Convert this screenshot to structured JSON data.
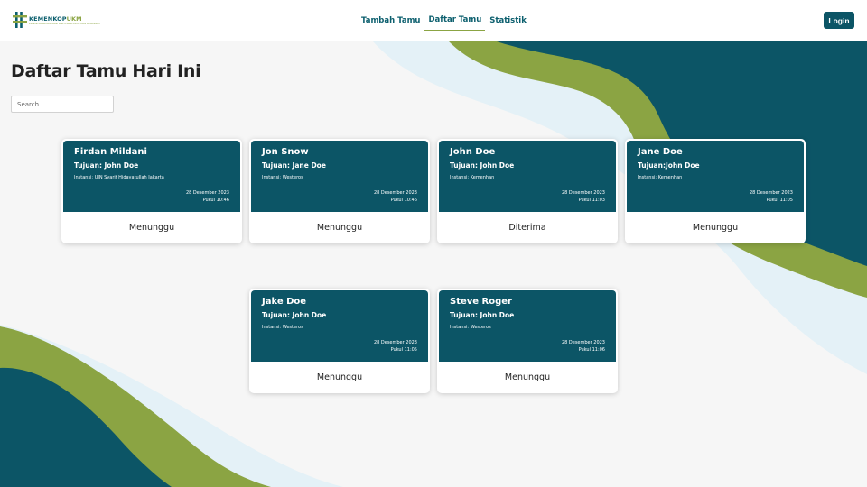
{
  "navbar": {
    "logo_text_main": "KEMENKOP",
    "logo_text_accent": "UKM",
    "logo_subtext": "KEMENTERIAN KOPERASI DAN USAHA KECIL DAN MENENGAH",
    "links": [
      {
        "label": "Tambah Tamu",
        "active": false
      },
      {
        "label": "Daftar Tamu",
        "active": true
      },
      {
        "label": "Statistik",
        "active": false
      }
    ],
    "login_label": "Login"
  },
  "page": {
    "title": "Daftar Tamu Hari Ini",
    "search_placeholder": "Search.."
  },
  "colors": {
    "primary": "#0c5566",
    "accent_green": "#8ba443",
    "light_blue": "#e4f1f7"
  },
  "guests": [
    {
      "name": "Firdan Mildani",
      "tujuan": "Tujuan:  John Doe",
      "instansi": "Instansi: UIN Syarif Hidayatullah Jakarta",
      "date": "28 Desember 2023",
      "time": "Pukul 10:46",
      "status": "Menunggu"
    },
    {
      "name": "Jon Snow",
      "tujuan": "Tujuan: Jane Doe",
      "instansi": "Instansi: Westeros",
      "date": "28 Desember 2023",
      "time": "Pukul 10:46",
      "status": "Menunggu"
    },
    {
      "name": "John Doe",
      "tujuan": "Tujuan: John Doe",
      "instansi": "Instansi: Kemenhan",
      "date": "28 Desember 2023",
      "time": "Pukul 11:03",
      "status": "Diterima"
    },
    {
      "name": "Jane Doe",
      "tujuan": "Tujuan:John Doe",
      "instansi": "Instansi: Kemenhan",
      "date": "28 Desember 2023",
      "time": "Pukul 11:05",
      "status": "Menunggu"
    },
    {
      "name": "Jake Doe",
      "tujuan": "Tujuan: John Doe",
      "instansi": "Instansi: Westeros",
      "date": "28 Desember 2023",
      "time": "Pukul 11:05",
      "status": "Menunggu"
    },
    {
      "name": "Steve Roger",
      "tujuan": "Tujuan: John Doe",
      "instansi": "Instansi: Westeros",
      "date": "28 Desember 2023",
      "time": "Pukul 11:06",
      "status": "Menunggu"
    }
  ]
}
